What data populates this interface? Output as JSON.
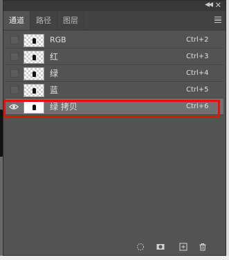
{
  "tabs": [
    {
      "label": "通道",
      "active": true
    },
    {
      "label": "路径",
      "active": false
    },
    {
      "label": "图层",
      "active": false
    }
  ],
  "channels": [
    {
      "name": "RGB",
      "shortcut": "Ctrl+2",
      "visible": false,
      "selected": false
    },
    {
      "name": "红",
      "shortcut": "Ctrl+3",
      "visible": false,
      "selected": false
    },
    {
      "name": "绿",
      "shortcut": "Ctrl+4",
      "visible": false,
      "selected": false
    },
    {
      "name": "蓝",
      "shortcut": "Ctrl+5",
      "visible": false,
      "selected": false
    },
    {
      "name": "绿 拷贝",
      "shortcut": "Ctrl+6",
      "visible": true,
      "selected": true
    }
  ],
  "icons": {
    "collapse": "double-chevron-left-icon",
    "close": "close-icon",
    "menu": "panel-menu-icon",
    "load_selection": "dotted-circle-icon",
    "save_selection": "mask-icon",
    "new_channel": "new-channel-icon",
    "delete": "trash-icon"
  },
  "colors": {
    "highlight": "#e0140c",
    "panel": "#535353",
    "selected_row": "#707070"
  }
}
